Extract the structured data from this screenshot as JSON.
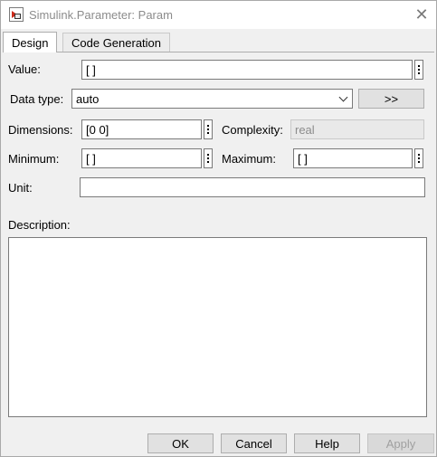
{
  "window": {
    "title": "Simulink.Parameter: Param",
    "app_icon": "simulink-parameter-icon",
    "close_glyph": "✕"
  },
  "tabs": [
    {
      "label": "Design",
      "active": true
    },
    {
      "label": "Code Generation",
      "active": false
    }
  ],
  "design": {
    "value_label": "Value:",
    "value": "[ ]",
    "datatype_label": "Data type:",
    "datatype_value": "auto",
    "datatype_button": ">>",
    "dimensions_label": "Dimensions:",
    "dimensions_value": "[0 0]",
    "complexity_label": "Complexity:",
    "complexity_value": "real",
    "minimum_label": "Minimum:",
    "minimum_value": "[ ]",
    "maximum_label": "Maximum:",
    "maximum_value": "[ ]",
    "unit_label": "Unit:",
    "unit_value": "",
    "description_label": "Description:",
    "description_value": ""
  },
  "buttons": {
    "ok": "OK",
    "cancel": "Cancel",
    "help": "Help",
    "apply": "Apply"
  }
}
